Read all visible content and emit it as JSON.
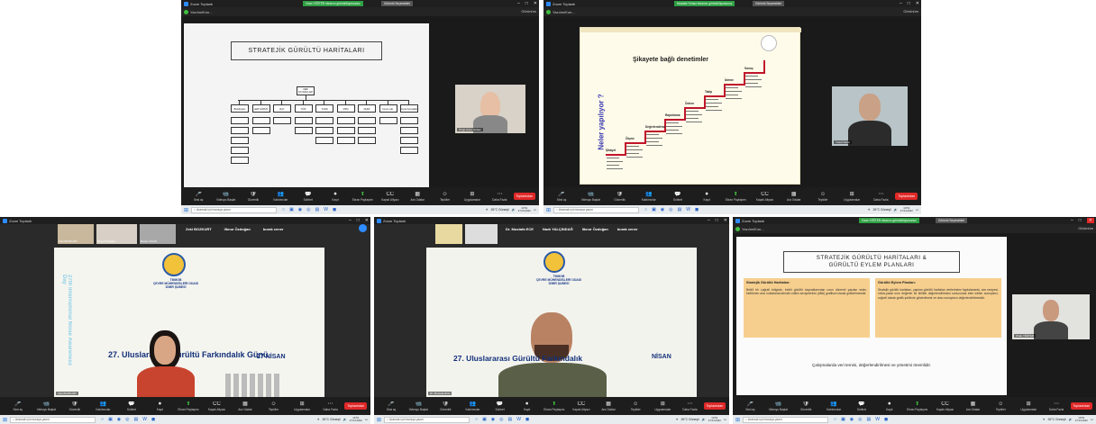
{
  "common": {
    "window_title": "Zoom Toplantı",
    "shield_label": "Yazılım/Kon...",
    "view_label": "Görünüm",
    "toolbar": [
      "Sesi aç",
      "Videoyu Başlat",
      "Güvenlik",
      "Katılımcılar",
      "Sohbet",
      "Kayıt",
      "Ekran Paylaşımı",
      "Kapalı Altyazı",
      "Ara Odalar",
      "Tepkiler",
      "Uygulamalar",
      "Daha Fazla"
    ],
    "leave_label": "Toplantıdan",
    "search_placeholder": "Aramak için buraya yazın",
    "weather": "26°C  Güneşli",
    "time": "13:51",
    "date": "27.04.2022"
  },
  "shots": [
    {
      "banner": "Ozan YİĞİTER ekranını görüntülüyorsunuz",
      "banner2": "Görüntü Seçenekleri",
      "slide": {
        "title": "STRATEJİK GÜRÜLTÜ HARİTALARI",
        "root": "VERİ\nKAYNAKLARI",
        "level1": [
          "Belediyeler",
          "Hafif GÜRÜN",
          "RAY",
          "TÜİK",
          "TCDD",
          "DSM",
          "DHMİ",
          "Çevre Lab.",
          "Ayrık Kaynaklar"
        ]
      },
      "video_name": "Özgü Uzun Gülser"
    },
    {
      "banner": "Mustafa Yılmaz ekranını görüntülüyorsunuz",
      "banner2": "Görüntü Seçenekleri",
      "slide": {
        "title": "Şikayete bağlı denetimler",
        "vertical": "Neler yapılıyor ?",
        "steps": [
          "Şikayet",
          "Ölçme",
          "Değerlendirme",
          "Raporlama",
          "Önlem",
          "Takip",
          "İzleme",
          "Sonuç"
        ]
      },
      "video_name": "Yusuf Gürel"
    },
    {
      "strip": [
        {
          "name": "Zeki BOZKURT"
        },
        {
          "name": "Ilknur Özdoğan"
        },
        {
          "name": "Burak CİHAN"
        }
      ],
      "labels": [
        "Zeki BOZKURT",
        "Ilknur Özdoğan",
        "burak cener"
      ],
      "poster": {
        "org": "TMMOB\nÇEVRE MÜHENDİSLERİ ODASI\nİZMİR ŞUBESİ",
        "headline": "27. Uluslararası Gürültü Farkındalık Günü",
        "date": "27 NİSAN",
        "side": "27th International Noise Awareness Day"
      },
      "video_name": "Zeki BOZKURT"
    },
    {
      "labels": [
        "Dr. Mustafa ECE",
        "Nazlı YALÇINDAĞ",
        "Ilknur Özdoğan",
        "burak cener"
      ],
      "poster": {
        "org": "TMMOB\nÇEVRE MÜHENDİSLERİ ODASI\nİZMİR ŞUBESİ",
        "headline": "27. Uluslararası Gürültü Farkındalık",
        "date": "NİSAN"
      },
      "video_name": "Dr. Mustafa ECE"
    },
    {
      "banner": "Ozan YİĞİTER ekranını görüntülüyorsunuz",
      "banner2": "Görüntü Seçenekleri",
      "slide": {
        "title": "STRATEJİK GÜRÜLTÜ HARİTALARI &\nGÜRÜLTÜ EYLEM PLANLARI",
        "box1_title": "Stratejik Gürültü Haritaları:",
        "box1_text": "Belirli bir coğrafi bölgede, belirli gürültü kaynaklarından uzun dönemli yapılan sesin, belirlenen alıcı noktalarda tahmini edilen seviyelerinin (dBA) grafiksel olarak gösterilmesidir.",
        "box2_title": "Gürültü Eylem Planları:",
        "box2_text": "Stratejik gürültü haritaları, yapılan gürültü haritaları verilerinden faydalanarak, ses seviyesi-nüfus-yasal sınır değerler ile birlikte değerlendirilmesi sonucunda elde edilen sonuçların, coğrafi olarak grafik şeklinde gösterilmesi ve olası sonuçların değerlendirilmesidir.",
        "footer": "Çalışmalarda veri temini, değerlendirilmesi ve yönetimi önemlidir."
      },
      "video_name": "Ozan YİĞİTER"
    }
  ]
}
